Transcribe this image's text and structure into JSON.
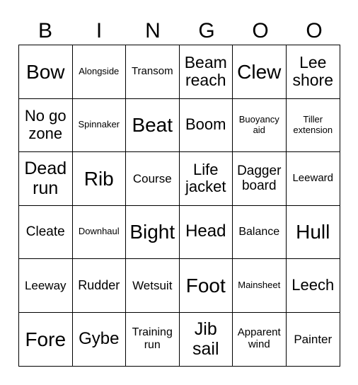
{
  "header": [
    "B",
    "I",
    "N",
    "G",
    "O",
    "O"
  ],
  "cells": [
    [
      "Bow",
      "Alongside",
      "Transom",
      "Beam reach",
      "Clew",
      "Lee shore"
    ],
    [
      "No go zone",
      "Spinnaker",
      "Beat",
      "Boom",
      "Buoyancy aid",
      "Tiller extension"
    ],
    [
      "Dead run",
      "Rib",
      "Course",
      "Life jacket",
      "Dagger board",
      "Leeward"
    ],
    [
      "Cleate",
      "Downhaul",
      "Bight",
      "Head",
      "Balance",
      "Hull"
    ],
    [
      "Leeway",
      "Rudder",
      "Wetsuit",
      "Foot",
      "Mainsheet",
      "Leech"
    ],
    [
      "Fore",
      "Gybe",
      "Training run",
      "Jib sail",
      "Apparent wind",
      "Painter"
    ]
  ]
}
